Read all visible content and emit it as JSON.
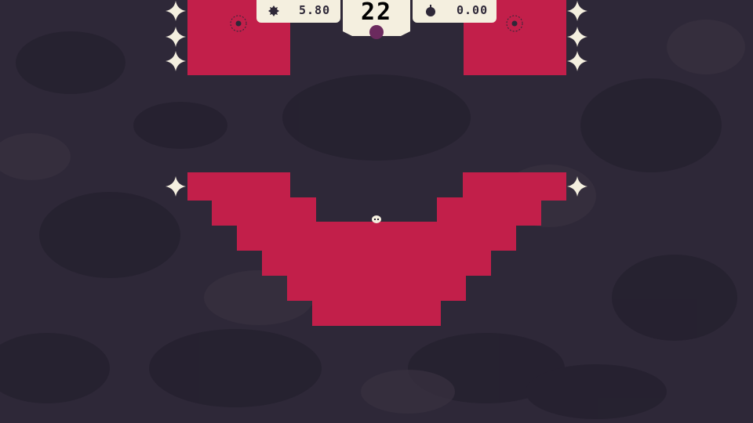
{
  "hud": {
    "left_time": "5.80",
    "right_time": "0.00",
    "level_number": "22"
  },
  "icons": {
    "left_hud_icon": "bomb-icon",
    "right_hud_icon": "apple-bomb-icon",
    "star": "sparkle-star-icon",
    "goal": "target-ring-icon",
    "player": "skull-ball-icon"
  },
  "colors": {
    "background": "#2e2838",
    "block": "#c21f4a",
    "hud_panel": "#f4efdf",
    "hud_text": "#2e2838",
    "player_marker": "#6b2a5e"
  }
}
